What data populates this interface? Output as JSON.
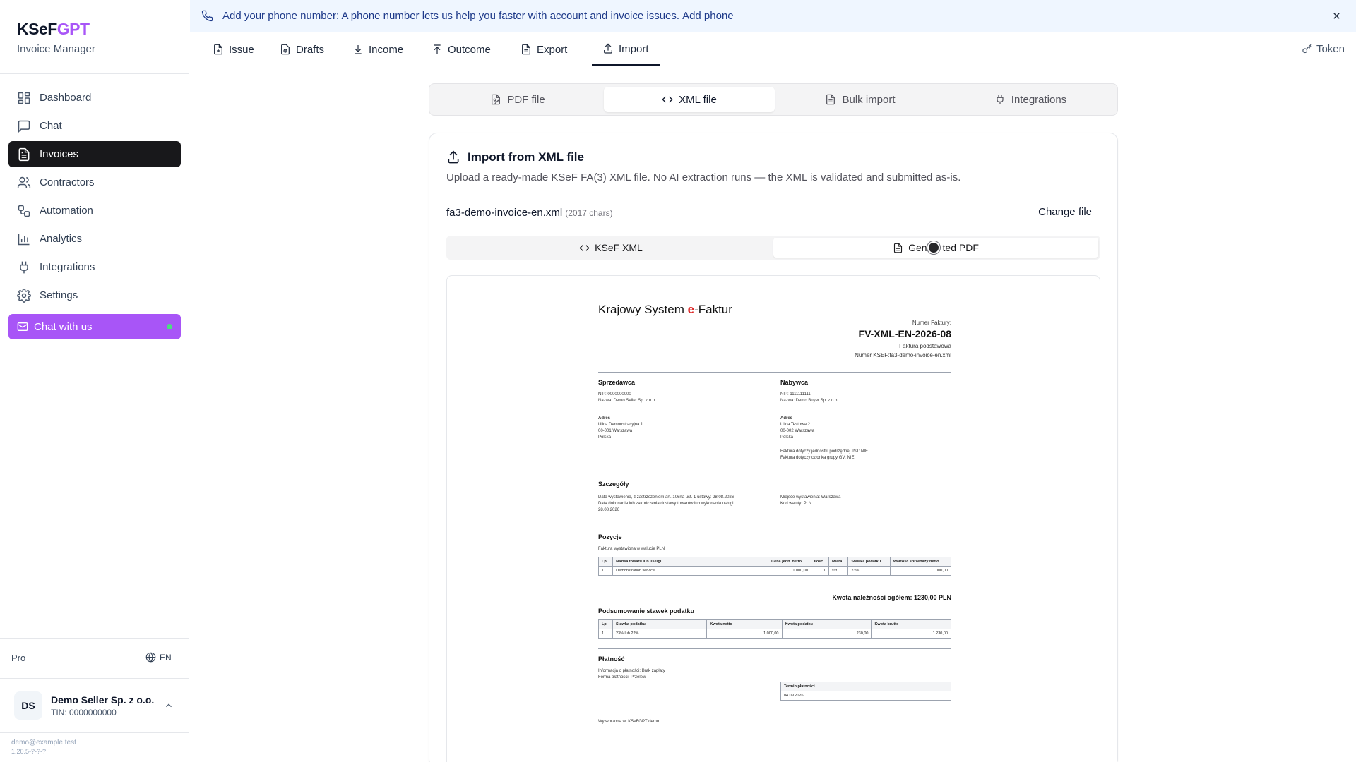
{
  "brand": {
    "name_a": "KSeF",
    "name_b": "GPT",
    "subtitle": "Invoice Manager"
  },
  "sidebar": {
    "items": [
      {
        "label": "Dashboard",
        "icon": "dashboard-icon"
      },
      {
        "label": "Chat",
        "icon": "chat-icon"
      },
      {
        "label": "Invoices",
        "icon": "document-icon",
        "active": true
      },
      {
        "label": "Contractors",
        "icon": "users-icon"
      },
      {
        "label": "Automation",
        "icon": "workflow-icon"
      },
      {
        "label": "Analytics",
        "icon": "bar-chart-icon"
      },
      {
        "label": "Integrations",
        "icon": "plug-icon"
      },
      {
        "label": "Settings",
        "icon": "gear-icon"
      }
    ],
    "chat_with_us": "Chat with us",
    "plan": "Pro",
    "language": "EN",
    "account": {
      "initials": "DS",
      "name": "Demo Seller Sp. z o.o.",
      "tin": "TIN: 0000000000"
    },
    "email": "demo@example.test",
    "version": "1.20.5-?-?-?"
  },
  "banner": {
    "text": "Add your phone number: A phone number lets us help you faster with account and invoice issues.",
    "link": "Add phone"
  },
  "top_tabs": [
    "Issue",
    "Drafts",
    "Income",
    "Outcome",
    "Export",
    "Import"
  ],
  "top_tabs_active": "Import",
  "token_label": "Token",
  "import_types": [
    "PDF file",
    "XML file",
    "Bulk import",
    "Integrations"
  ],
  "import_types_active": "XML file",
  "card": {
    "title": "Import from XML file",
    "description": "Upload a ready-made KSeF FA(3) XML file. No AI extraction runs — the XML is validated and submitted as-is.",
    "file_name": "fa3-demo-invoice-en.xml",
    "file_chars": "(2017 chars)",
    "change_file": "Change file",
    "view_tabs": [
      "KSeF XML",
      "Generated PDF"
    ],
    "view_tabs_visible": [
      "KSeF XML",
      "Gen",
      "ted PDF"
    ],
    "view_active": "Generated PDF"
  },
  "pdf": {
    "title_a": "Krajowy System ",
    "title_b": "e",
    "title_c": "-Faktur",
    "number_label": "Numer Faktury:",
    "number": "FV-XML-EN-2026-08",
    "kind": "Faktura podstawowa",
    "ksef_number": "Numer KSEF:fa3-demo-invoice-en.xml",
    "seller_h": "Sprzedawca",
    "seller_lines": [
      "NIP: 0000000000",
      "Nazwa: Demo Seller Sp. z o.o."
    ],
    "seller_addr": [
      "Adres",
      "Ulica Demonstracyjna 1",
      "00-001 Warszawa",
      "Polska"
    ],
    "buyer_h": "Nabywca",
    "buyer_lines": [
      "NIP: 1111111111",
      "Nazwa: Demo Buyer Sp. z o.o."
    ],
    "buyer_addr": [
      "Adres",
      "Ulica Testowa 2",
      "00-002 Warszawa",
      "Polska"
    ],
    "buyer_flags": [
      "Faktura dotyczy jednostki podrzędnej JST: NIE",
      "Faktura dotyczy członka grupy GV: NIE"
    ],
    "details_h": "Szczegóły",
    "details_left": [
      "Data wystawienia, z zastrzeżeniem art. 106na ust. 1 ustawy: 28.08.2026",
      "Data dokonania lub zakończenia dostawy towarów lub wykonania usługi:",
      "28.08.2026"
    ],
    "details_right": [
      "Miejsce wystawienia: Warszawa",
      "Kod waluty: PLN"
    ],
    "items_h": "Pozycje",
    "items_sub": "Faktura wystawiona w walucie PLN",
    "items_head": [
      "Lp.",
      "Nazwa towaru lub usługi",
      "Cena jedn. netto",
      "Ilość",
      "Miara",
      "Stawka podatku",
      "Wartość sprzedaży netto"
    ],
    "items_row": [
      "1",
      "Demonstration service",
      "1 000,00",
      "1",
      "szt.",
      "23%",
      "1 000,00"
    ],
    "total": "Kwota należności ogółem: 1230,00 PLN",
    "tax_h": "Podsumowanie stawek podatku",
    "tax_head": [
      "Lp.",
      "Stawka podatku",
      "Kwota netto",
      "Kwota podatku",
      "Kwota brutto"
    ],
    "tax_row": [
      "1",
      "23% lub 22%",
      "1 000,00",
      "230,00",
      "1 230,00"
    ],
    "payment_h": "Płatność",
    "payment_lines": [
      "Informacja o płatności: Brak zapłaty",
      "Forma płatności: Przelew"
    ],
    "due_head": "Termin płatności",
    "due_value": "04.09.2026",
    "generated": "Wytworzona w: KSeFGPT demo"
  }
}
